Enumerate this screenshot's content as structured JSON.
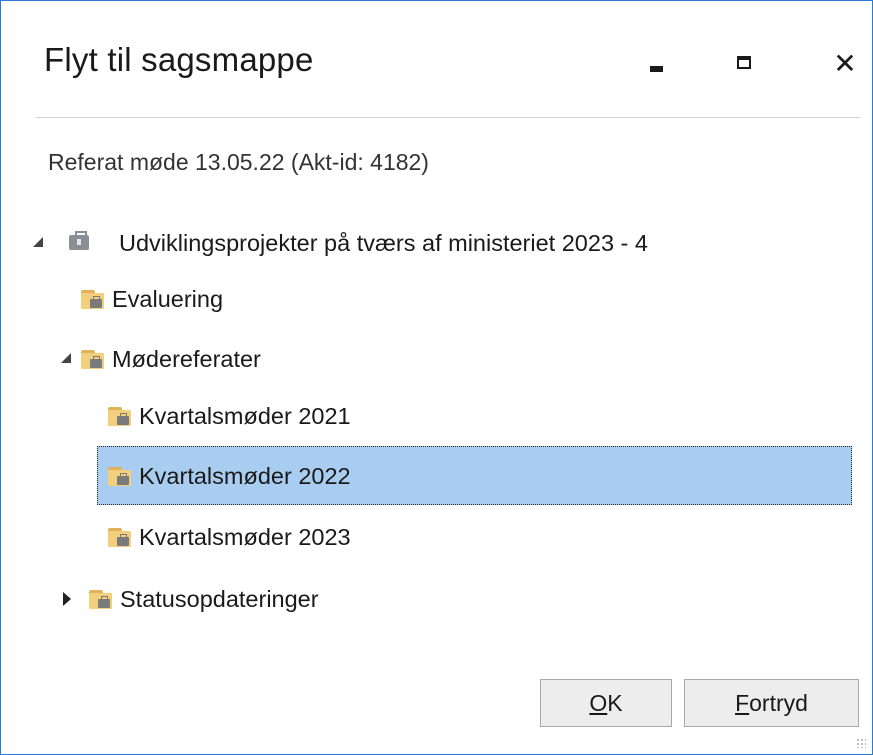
{
  "window": {
    "title": "Flyt til sagsmappe",
    "buttons": {
      "minimize_icon": "minimize-icon",
      "maximize_icon": "maximize-icon",
      "close_symbol": "✕"
    }
  },
  "document_label": "Referat møde 13.05.22 (Akt-id: 4182)",
  "tree": {
    "root": {
      "label": "Udviklingsprojekter på tværs af ministeriet 2023 - 4",
      "icon": "case-icon",
      "expanded": true
    },
    "children": [
      {
        "label": "Evaluering",
        "icon": "folder-icon"
      },
      {
        "label": "Mødereferater",
        "icon": "folder-icon",
        "expanded": true,
        "children": [
          {
            "label": "Kvartalsmøder 2021",
            "icon": "folder-icon"
          },
          {
            "label": "Kvartalsmøder 2022",
            "icon": "folder-icon",
            "selected": true
          },
          {
            "label": "Kvartalsmøder 2023",
            "icon": "folder-icon"
          }
        ]
      },
      {
        "label": "Statusopdateringer",
        "icon": "folder-icon",
        "expanded": false
      }
    ]
  },
  "actions": {
    "ok_label_rest": "K",
    "ok_label_mnemonic": "O",
    "cancel_label_mnemonic": "F",
    "cancel_label_rest": "ortryd"
  },
  "colors": {
    "selection": "#a9cdf0",
    "folder": "#f2cf7c",
    "border": "#2b7bd3"
  }
}
